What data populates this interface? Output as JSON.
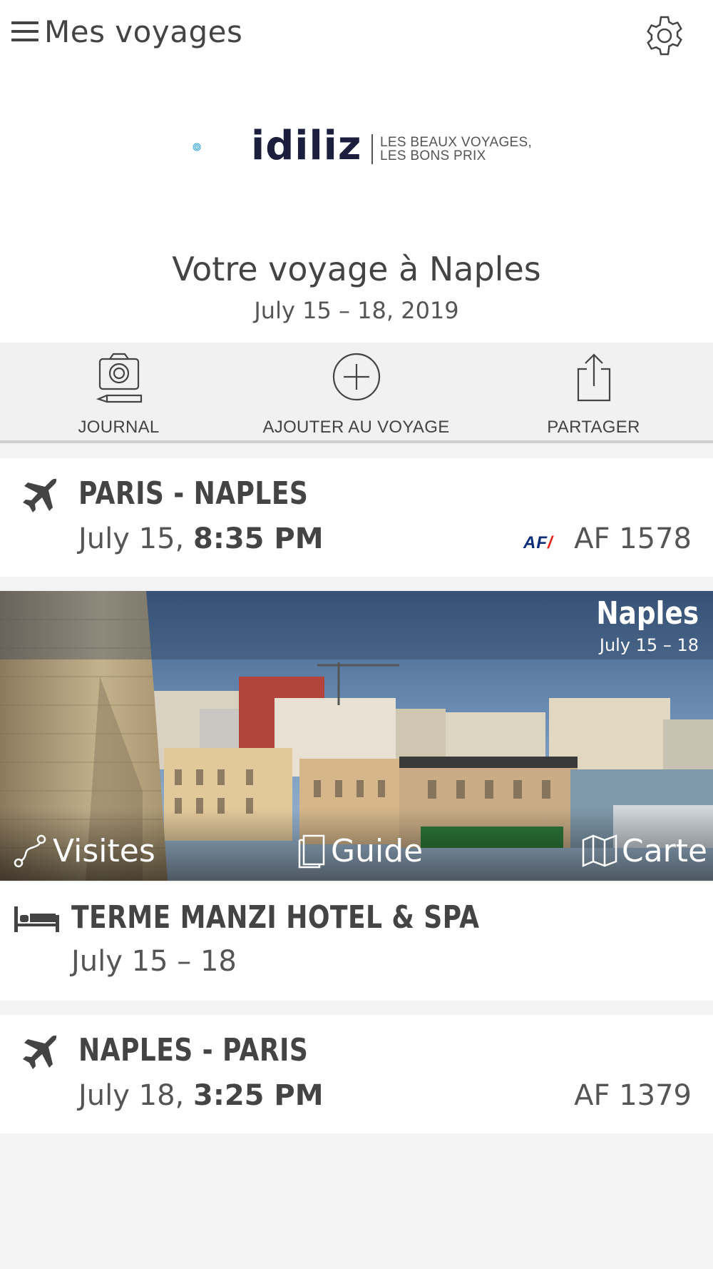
{
  "header": {
    "title": "Mes voyages"
  },
  "logo": {
    "brand": "idiliz",
    "tagline_1": "LES BEAUX VOYAGES,",
    "tagline_2": "LES BONS PRIX"
  },
  "trip": {
    "title": "Votre voyage à Naples",
    "dates": "July 15 – 18, 2019"
  },
  "actions": [
    {
      "label": "JOURNAL",
      "icon": "camera-pencil-icon"
    },
    {
      "label": "AJOUTER AU VOYAGE",
      "icon": "plus-circle-icon"
    },
    {
      "label": "PARTAGER",
      "icon": "share-icon"
    }
  ],
  "flights": [
    {
      "route": "PARIS - NAPLES",
      "date": "July 15,",
      "time": "8:35 PM",
      "airline": "AF",
      "number": "AF 1578"
    },
    {
      "route": "NAPLES - PARIS",
      "date": "July 18,",
      "time": "3:25 PM",
      "number": "AF 1379"
    }
  ],
  "destination": {
    "name": "Naples",
    "dates": "July 15 – 18",
    "links": [
      {
        "label": "Visites",
        "icon": "route-icon"
      },
      {
        "label": "Guide",
        "icon": "book-icon"
      },
      {
        "label": "Carte",
        "icon": "map-icon"
      }
    ]
  },
  "hotel": {
    "name": "TERME MANZI HOTEL & SPA",
    "dates": "July 15 – 18"
  }
}
